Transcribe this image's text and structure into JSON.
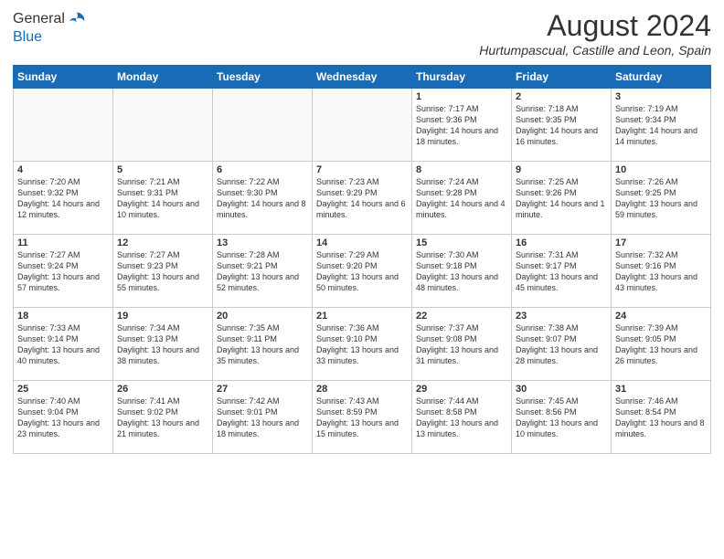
{
  "logo": {
    "line1": "General",
    "line2": "Blue"
  },
  "header": {
    "month_year": "August 2024",
    "location": "Hurtumpascual, Castille and Leon, Spain"
  },
  "days_of_week": [
    "Sunday",
    "Monday",
    "Tuesday",
    "Wednesday",
    "Thursday",
    "Friday",
    "Saturday"
  ],
  "weeks": [
    [
      {
        "day": "",
        "info": ""
      },
      {
        "day": "",
        "info": ""
      },
      {
        "day": "",
        "info": ""
      },
      {
        "day": "",
        "info": ""
      },
      {
        "day": "1",
        "info": "Sunrise: 7:17 AM\nSunset: 9:36 PM\nDaylight: 14 hours and 18 minutes."
      },
      {
        "day": "2",
        "info": "Sunrise: 7:18 AM\nSunset: 9:35 PM\nDaylight: 14 hours and 16 minutes."
      },
      {
        "day": "3",
        "info": "Sunrise: 7:19 AM\nSunset: 9:34 PM\nDaylight: 14 hours and 14 minutes."
      }
    ],
    [
      {
        "day": "4",
        "info": "Sunrise: 7:20 AM\nSunset: 9:32 PM\nDaylight: 14 hours and 12 minutes."
      },
      {
        "day": "5",
        "info": "Sunrise: 7:21 AM\nSunset: 9:31 PM\nDaylight: 14 hours and 10 minutes."
      },
      {
        "day": "6",
        "info": "Sunrise: 7:22 AM\nSunset: 9:30 PM\nDaylight: 14 hours and 8 minutes."
      },
      {
        "day": "7",
        "info": "Sunrise: 7:23 AM\nSunset: 9:29 PM\nDaylight: 14 hours and 6 minutes."
      },
      {
        "day": "8",
        "info": "Sunrise: 7:24 AM\nSunset: 9:28 PM\nDaylight: 14 hours and 4 minutes."
      },
      {
        "day": "9",
        "info": "Sunrise: 7:25 AM\nSunset: 9:26 PM\nDaylight: 14 hours and 1 minute."
      },
      {
        "day": "10",
        "info": "Sunrise: 7:26 AM\nSunset: 9:25 PM\nDaylight: 13 hours and 59 minutes."
      }
    ],
    [
      {
        "day": "11",
        "info": "Sunrise: 7:27 AM\nSunset: 9:24 PM\nDaylight: 13 hours and 57 minutes."
      },
      {
        "day": "12",
        "info": "Sunrise: 7:27 AM\nSunset: 9:23 PM\nDaylight: 13 hours and 55 minutes."
      },
      {
        "day": "13",
        "info": "Sunrise: 7:28 AM\nSunset: 9:21 PM\nDaylight: 13 hours and 52 minutes."
      },
      {
        "day": "14",
        "info": "Sunrise: 7:29 AM\nSunset: 9:20 PM\nDaylight: 13 hours and 50 minutes."
      },
      {
        "day": "15",
        "info": "Sunrise: 7:30 AM\nSunset: 9:18 PM\nDaylight: 13 hours and 48 minutes."
      },
      {
        "day": "16",
        "info": "Sunrise: 7:31 AM\nSunset: 9:17 PM\nDaylight: 13 hours and 45 minutes."
      },
      {
        "day": "17",
        "info": "Sunrise: 7:32 AM\nSunset: 9:16 PM\nDaylight: 13 hours and 43 minutes."
      }
    ],
    [
      {
        "day": "18",
        "info": "Sunrise: 7:33 AM\nSunset: 9:14 PM\nDaylight: 13 hours and 40 minutes."
      },
      {
        "day": "19",
        "info": "Sunrise: 7:34 AM\nSunset: 9:13 PM\nDaylight: 13 hours and 38 minutes."
      },
      {
        "day": "20",
        "info": "Sunrise: 7:35 AM\nSunset: 9:11 PM\nDaylight: 13 hours and 35 minutes."
      },
      {
        "day": "21",
        "info": "Sunrise: 7:36 AM\nSunset: 9:10 PM\nDaylight: 13 hours and 33 minutes."
      },
      {
        "day": "22",
        "info": "Sunrise: 7:37 AM\nSunset: 9:08 PM\nDaylight: 13 hours and 31 minutes."
      },
      {
        "day": "23",
        "info": "Sunrise: 7:38 AM\nSunset: 9:07 PM\nDaylight: 13 hours and 28 minutes."
      },
      {
        "day": "24",
        "info": "Sunrise: 7:39 AM\nSunset: 9:05 PM\nDaylight: 13 hours and 26 minutes."
      }
    ],
    [
      {
        "day": "25",
        "info": "Sunrise: 7:40 AM\nSunset: 9:04 PM\nDaylight: 13 hours and 23 minutes."
      },
      {
        "day": "26",
        "info": "Sunrise: 7:41 AM\nSunset: 9:02 PM\nDaylight: 13 hours and 21 minutes."
      },
      {
        "day": "27",
        "info": "Sunrise: 7:42 AM\nSunset: 9:01 PM\nDaylight: 13 hours and 18 minutes."
      },
      {
        "day": "28",
        "info": "Sunrise: 7:43 AM\nSunset: 8:59 PM\nDaylight: 13 hours and 15 minutes."
      },
      {
        "day": "29",
        "info": "Sunrise: 7:44 AM\nSunset: 8:58 PM\nDaylight: 13 hours and 13 minutes."
      },
      {
        "day": "30",
        "info": "Sunrise: 7:45 AM\nSunset: 8:56 PM\nDaylight: 13 hours and 10 minutes."
      },
      {
        "day": "31",
        "info": "Sunrise: 7:46 AM\nSunset: 8:54 PM\nDaylight: 13 hours and 8 minutes."
      }
    ]
  ]
}
